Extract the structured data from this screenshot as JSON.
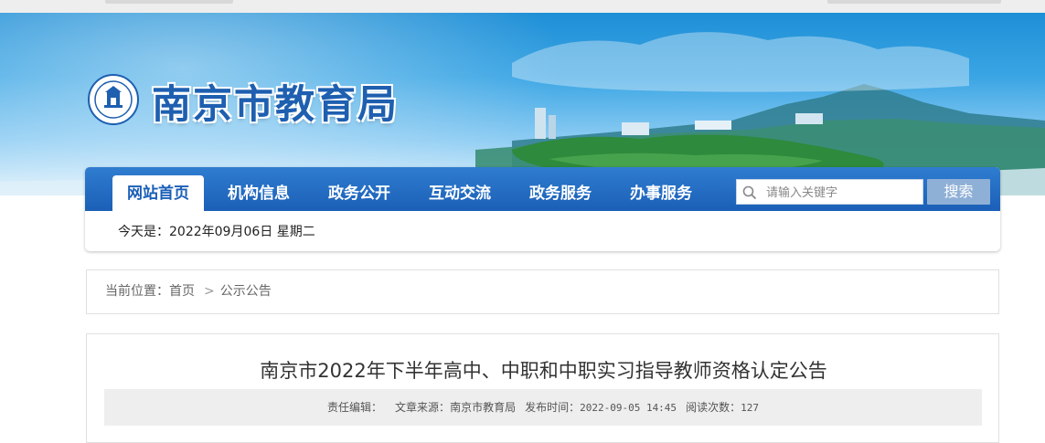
{
  "header": {
    "site_title": "南京市教育局",
    "logo_name": "nanjing-education-emblem"
  },
  "nav": {
    "items": [
      {
        "label": "网站首页",
        "active": true
      },
      {
        "label": "机构信息",
        "active": false
      },
      {
        "label": "政务公开",
        "active": false
      },
      {
        "label": "互动交流",
        "active": false
      },
      {
        "label": "政务服务",
        "active": false
      },
      {
        "label": "办事服务",
        "active": false
      }
    ],
    "search_placeholder": "请输入关键字",
    "search_button": "搜索",
    "date_label": "今天是：",
    "date_value": "2022年09月06日",
    "weekday": "星期二"
  },
  "breadcrumb": {
    "prefix": "当前位置：",
    "items": [
      "首页",
      "公示公告"
    ],
    "separator": ">"
  },
  "article": {
    "title": "南京市2022年下半年高中、中职和中职实习指导教师资格认定公告",
    "editor_label": "责任编辑：",
    "editor": "",
    "source_label": "文章来源：",
    "source": "南京市教育局",
    "published_label": "发布时间：",
    "published": "2022-09-05 14:45",
    "views_label": "阅读次数：",
    "views": "127"
  },
  "colors": {
    "nav_blue": "#1b5fb7",
    "title_blue": "#1e5fb0",
    "search_button": "#8fb0d6"
  }
}
